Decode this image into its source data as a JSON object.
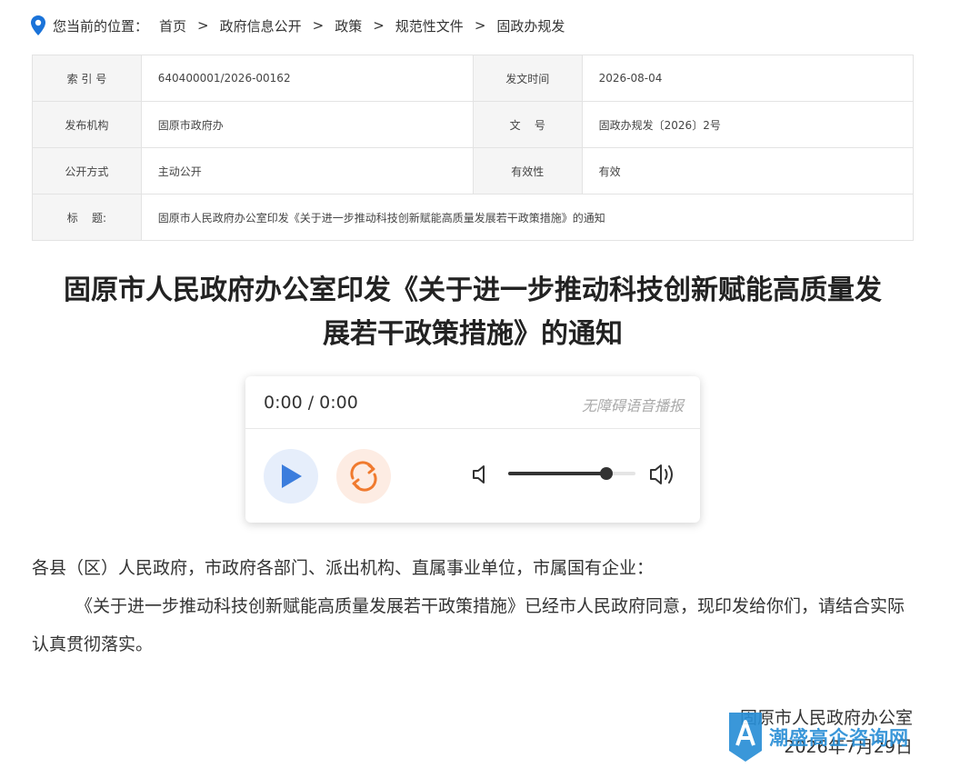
{
  "breadcrumb": {
    "prefix": "您当前的位置：",
    "items": [
      "首页",
      "政府信息公开",
      "政策",
      "规范性文件",
      "固政办规发"
    ]
  },
  "meta": {
    "index_label": "索 引 号",
    "index_value": "640400001/2026-00162",
    "date_label": "发文时间",
    "date_value": "2026-08-04",
    "org_label": "发布机构",
    "org_value": "固原市政府办",
    "doc_label": "文    号",
    "doc_value": "固政办规发〔2026〕2号",
    "mode_label": "公开方式",
    "mode_value": "主动公开",
    "valid_label": "有效性",
    "valid_value": "有效",
    "title_label": "标    题:",
    "title_value": "固原市人民政府办公室印发《关于进一步推动科技创新赋能高质量发展若干政策措施》的通知"
  },
  "article": {
    "title_line1": "固原市人民政府办公室印发《关于进一步推动科技创新赋能高质量发",
    "title_line2": "展若干政策措施》的通知",
    "salutation": "各县（区）人民政府，市政府各部门、派出机构、直属事业单位，市属国有企业：",
    "paragraph1": "《关于进一步推动科技创新赋能高质量发展若干政策措施》已经市人民政府同意，现印发给你们，请结合实际认真贯彻落实。",
    "signer": "固原市人民政府办公室",
    "sign_date": "2026年7月29日"
  },
  "player": {
    "time": "0:00 / 0:00",
    "hint": "无障碍语音播报",
    "volume": 0.77,
    "colors": {
      "play": "#3b7ddd",
      "loop": "#f07a2e"
    }
  },
  "watermark": {
    "text": "潮盛高企咨询网"
  },
  "colors": {
    "accent": "#1a73d9",
    "table_label_bg": "#f5f5f5"
  }
}
